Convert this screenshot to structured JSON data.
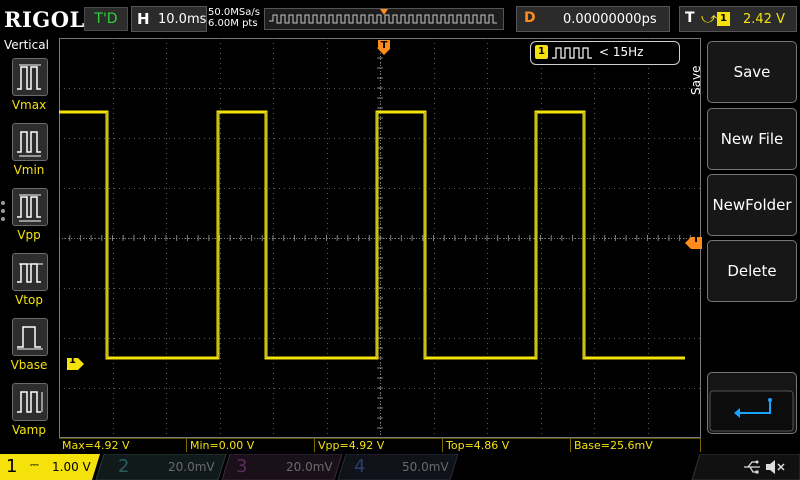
{
  "brand": "RIGOL",
  "top_bar": {
    "run_status": "T'D",
    "horizontal_label": "H",
    "timebase": "10.0ms",
    "sample_rate": "50.0MSa/s",
    "memory_depth": "6.00M pts",
    "delay_label": "D",
    "delay_value": "0.00000000ps",
    "trigger_label": "T",
    "trigger_source": "1",
    "trigger_level": "2.42 V"
  },
  "left_menu": {
    "title": "Vertical",
    "items": [
      {
        "label": "Vmax",
        "icon": "vmax-icon"
      },
      {
        "label": "Vmin",
        "icon": "vmin-icon"
      },
      {
        "label": "Vpp",
        "icon": "vpp-icon"
      },
      {
        "label": "Vtop",
        "icon": "vtop-icon"
      },
      {
        "label": "Vbase",
        "icon": "vbase-icon"
      },
      {
        "label": "Vamp",
        "icon": "vamp-icon"
      }
    ]
  },
  "right_menu": {
    "title": "Save",
    "buttons": [
      {
        "label": "Save"
      },
      {
        "label": "New File"
      },
      {
        "label": "NewFolder"
      },
      {
        "label": "Delete"
      }
    ],
    "return_icon": "return-arrow-icon"
  },
  "frequency_counter": {
    "channel": "1",
    "text": "< 15Hz"
  },
  "channel1_marker": "1",
  "trigger_level_marker": "T",
  "trigger_position_marker": "T",
  "measurements": [
    {
      "text": "Max=4.92 V"
    },
    {
      "text": "Min=0.00 V"
    },
    {
      "text": "Vpp=4.92 V"
    },
    {
      "text": "Top=4.86 V"
    },
    {
      "text": "Base=25.6mV"
    }
  ],
  "channels": [
    {
      "num": "1",
      "scale": "1.00 V",
      "color": "#f4e20a",
      "active": true
    },
    {
      "num": "2",
      "scale": "20.0mV",
      "color": "#00c8c8",
      "active": false
    },
    {
      "num": "3",
      "scale": "20.0mV",
      "color": "#d800d8",
      "active": false
    },
    {
      "num": "4",
      "scale": "50.0mV",
      "color": "#2a7fff",
      "active": false
    }
  ],
  "status_icons": [
    "usb-icon",
    "speaker-muted-icon"
  ],
  "colors": {
    "trace": "#f4e20a",
    "grid": "#5a5a5a",
    "trigger_marker": "#ff8c1a",
    "run_status": "#2ad43a",
    "return_arrow": "#1aa3ff"
  },
  "waveform": {
    "type": "square",
    "high_level_v": 4.92,
    "low_level_v": 0.0,
    "frequency": "< 15Hz"
  }
}
